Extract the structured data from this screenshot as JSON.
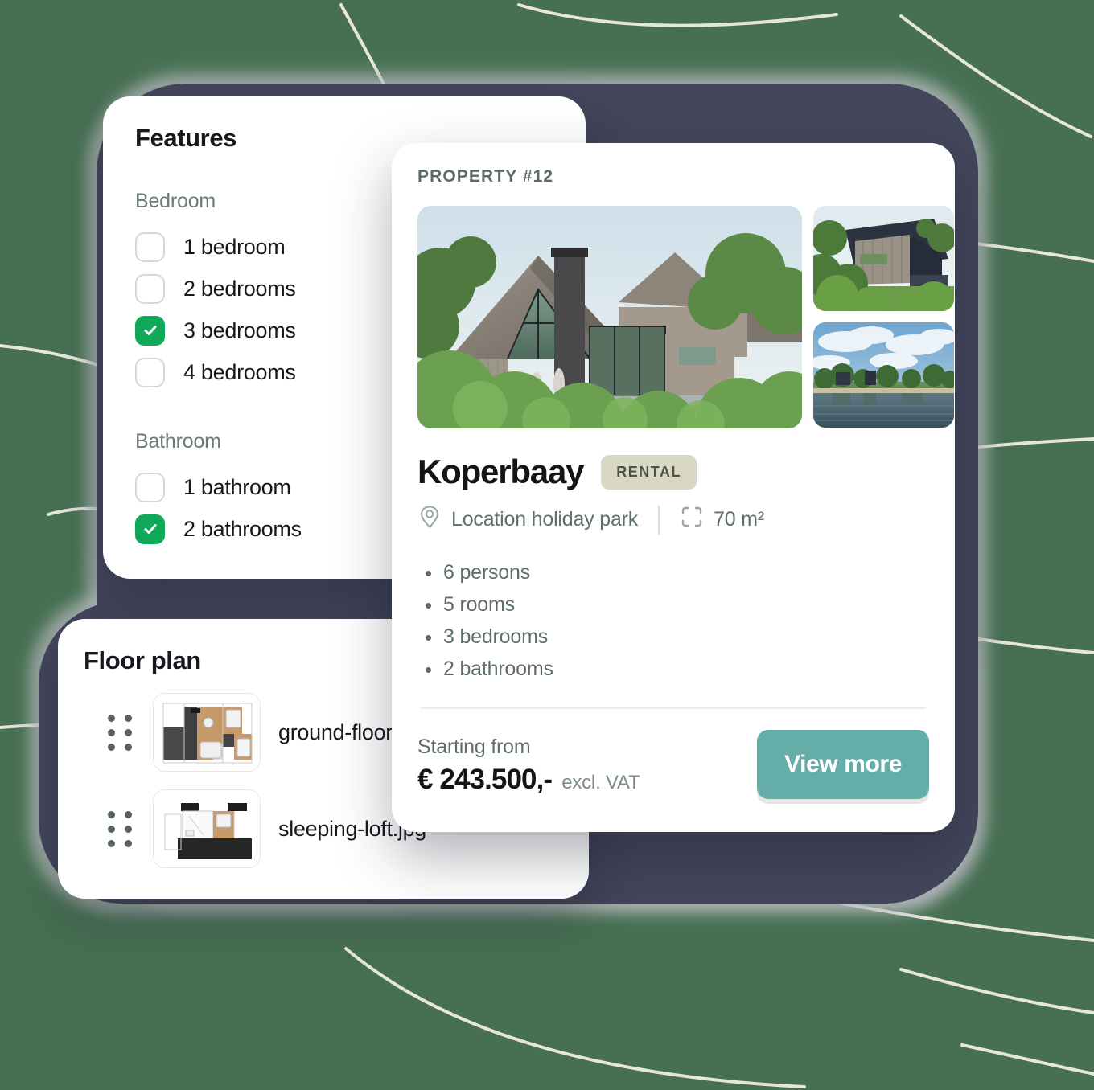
{
  "theme": {
    "page_background": "#477053",
    "blob_color": "#44465c",
    "accent_green": "#10a95a",
    "accent_teal": "#64ada8",
    "badge_bg": "#d9d8c5",
    "line_color": "#e8e6dc",
    "card_bg": "#ffffff"
  },
  "features_card": {
    "title": "Features",
    "groups": [
      {
        "label": "Bedroom",
        "options": [
          {
            "label": "1 bedroom",
            "checked": false
          },
          {
            "label": "2 bedrooms",
            "checked": false
          },
          {
            "label": "3 bedrooms",
            "checked": true
          },
          {
            "label": "4 bedrooms",
            "checked": false
          }
        ]
      },
      {
        "label": "Bathroom",
        "options": [
          {
            "label": "1 bathroom",
            "checked": false
          },
          {
            "label": "2 bathrooms",
            "checked": true
          }
        ]
      }
    ]
  },
  "floorplan_card": {
    "title": "Floor plan",
    "items": [
      {
        "name": "ground-floor.jpg",
        "thumb": "ground-floor-plan"
      },
      {
        "name": "sleeping-loft.jpg",
        "thumb": "sleeping-loft-plan"
      }
    ]
  },
  "property_card": {
    "eyebrow": "PROPERTY #12",
    "gallery": {
      "hero_alt": "modern-gabled-house-exterior",
      "thumbs": [
        {
          "alt": "house-side-view"
        },
        {
          "alt": "lakeside-view"
        }
      ]
    },
    "title": "Koperbaay",
    "badge": "RENTAL",
    "location": "Location holiday park",
    "area": "70 m²",
    "specs": [
      "6 persons",
      "5 rooms",
      "3 bedrooms",
      "2 bathrooms"
    ],
    "price_label": "Starting from",
    "price": "€ 243.500,-",
    "price_note": "excl. VAT",
    "cta": "View more"
  }
}
